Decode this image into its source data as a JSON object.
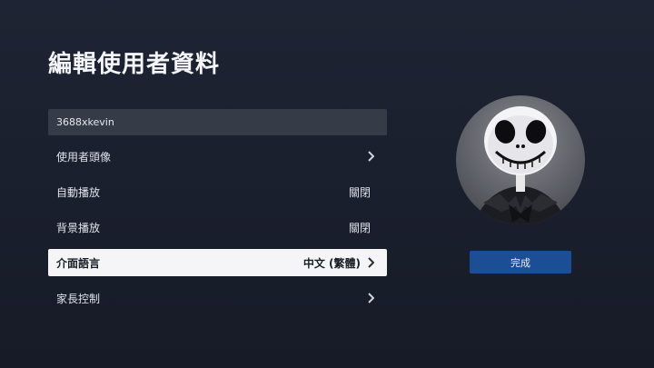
{
  "page": {
    "title": "編輯使用者資料"
  },
  "profile_name": {
    "value": "3688xkevin"
  },
  "menu": {
    "items": [
      {
        "label": "使用者頭像",
        "value": ""
      },
      {
        "label": "自動播放",
        "value": "關閉"
      },
      {
        "label": "背景播放",
        "value": "關閉"
      },
      {
        "label": "介面語言",
        "value": "中文 (繁體)"
      },
      {
        "label": "家長控制",
        "value": ""
      }
    ]
  },
  "done_button": {
    "label": "完成"
  },
  "icons": {
    "chevron": "chevron-right-icon",
    "avatar": "jack-skellington-avatar"
  },
  "colors": {
    "accent": "#1c4e96",
    "selected_row": "#f5f5f7",
    "field_bg": "#363b48"
  }
}
